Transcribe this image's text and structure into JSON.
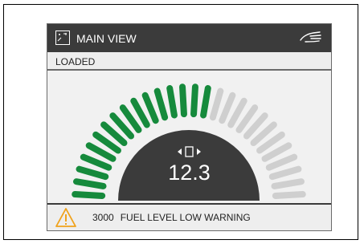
{
  "header": {
    "title": "MAIN VIEW",
    "left_icon": "view-icon",
    "right_icon": "hand-icon"
  },
  "status": {
    "text": "LOADED"
  },
  "gauge": {
    "value": "12.3",
    "segments_total": 28,
    "segments_active": 16,
    "active_color": "#168a3c",
    "inactive_color": "#cfcfcf",
    "center_icon": "tilt-indicator-icon"
  },
  "footer": {
    "code": "3000",
    "message": "FUEL LEVEL LOW WARNING",
    "icon": "warning-icon",
    "icon_color": "#f0a21b"
  }
}
